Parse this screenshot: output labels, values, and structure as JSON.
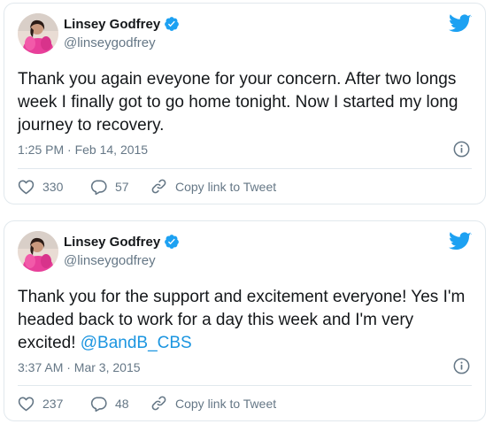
{
  "colors": {
    "accent": "#1da1f2",
    "link": "#1b95e0",
    "secondary_text": "#657786",
    "border": "#e1e8ed"
  },
  "tweets": [
    {
      "author": {
        "name": "Linsey Godfrey",
        "handle": "@linseygodfrey",
        "verified": true
      },
      "text": "Thank you again eveyone for your concern. After two longs week I finally got to go home tonight. Now I started my long journey to recovery.",
      "timestamp": "1:25 PM · Feb 14, 2015",
      "likes": "330",
      "replies": "57",
      "copy_link_label": "Copy link to Tweet",
      "icons": [
        "twitter-bird-icon",
        "verified-badge-icon",
        "info-icon",
        "heart-icon",
        "reply-bubble-icon",
        "link-icon"
      ]
    },
    {
      "author": {
        "name": "Linsey Godfrey",
        "handle": "@linseygodfrey",
        "verified": true
      },
      "text_main": "Thank you for the support and excitement everyone! Yes I'm headed back to work for a day this week and I'm very excited! ",
      "mention": "@BandB_CBS",
      "timestamp": "3:37 AM · Mar 3, 2015",
      "likes": "237",
      "replies": "48",
      "copy_link_label": "Copy link to Tweet",
      "icons": [
        "twitter-bird-icon",
        "verified-badge-icon",
        "info-icon",
        "heart-icon",
        "reply-bubble-icon",
        "link-icon"
      ]
    }
  ]
}
